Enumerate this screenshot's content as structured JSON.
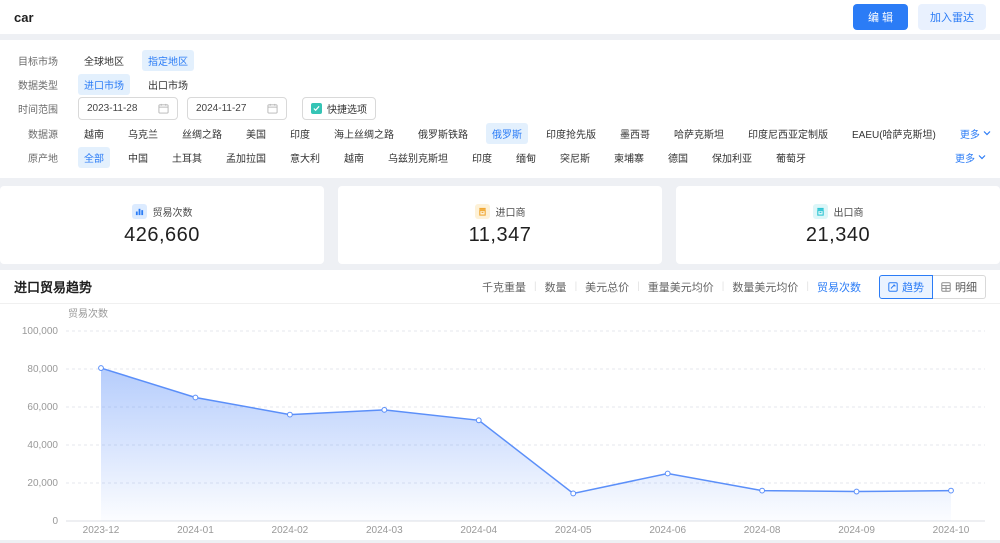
{
  "topbar": {
    "title": "car",
    "edit_label": "编 辑",
    "add_radar_label": "加入雷达"
  },
  "filters": {
    "market": {
      "label": "目标市场",
      "options": [
        {
          "text": "全球地区",
          "selected": false
        },
        {
          "text": "指定地区",
          "selected": true
        }
      ]
    },
    "data_type": {
      "label": "数据类型",
      "options": [
        {
          "text": "进口市场",
          "selected": true
        },
        {
          "text": "出口市场",
          "selected": false
        }
      ]
    },
    "date_range": {
      "label": "时间范围",
      "start": "2023-11-28",
      "end": "2024-11-27",
      "quick_label": "快捷选项"
    },
    "data_source": {
      "label": "数据源",
      "more_label": "更多",
      "options": [
        {
          "text": "越南",
          "selected": false
        },
        {
          "text": "乌克兰",
          "selected": false
        },
        {
          "text": "丝绸之路",
          "selected": false
        },
        {
          "text": "美国",
          "selected": false
        },
        {
          "text": "印度",
          "selected": false
        },
        {
          "text": "海上丝绸之路",
          "selected": false
        },
        {
          "text": "俄罗斯铁路",
          "selected": false
        },
        {
          "text": "俄罗斯",
          "selected": true
        },
        {
          "text": "印度抢先版",
          "selected": false
        },
        {
          "text": "墨西哥",
          "selected": false
        },
        {
          "text": "哈萨克斯坦",
          "selected": false
        },
        {
          "text": "印度尼西亚定制版",
          "selected": false
        },
        {
          "text": "EAEU(哈萨克斯坦)",
          "selected": false
        }
      ]
    },
    "origin": {
      "label": "原产地",
      "more_label": "更多",
      "options": [
        {
          "text": "全部",
          "selected": true
        },
        {
          "text": "中国",
          "selected": false
        },
        {
          "text": "土耳其",
          "selected": false
        },
        {
          "text": "孟加拉国",
          "selected": false
        },
        {
          "text": "意大利",
          "selected": false
        },
        {
          "text": "越南",
          "selected": false
        },
        {
          "text": "乌兹别克斯坦",
          "selected": false
        },
        {
          "text": "印度",
          "selected": false
        },
        {
          "text": "缅甸",
          "selected": false
        },
        {
          "text": "突尼斯",
          "selected": false
        },
        {
          "text": "柬埔寨",
          "selected": false
        },
        {
          "text": "德国",
          "selected": false
        },
        {
          "text": "保加利亚",
          "selected": false
        },
        {
          "text": "葡萄牙",
          "selected": false
        }
      ]
    }
  },
  "stats": [
    {
      "label": "贸易次数",
      "value": "426,660",
      "icon": "bar-chart-icon",
      "color": "#2b7cf6",
      "bg": "#dcebff"
    },
    {
      "label": "进口商",
      "value": "11,347",
      "icon": "importer-icon",
      "color": "#f0a732",
      "bg": "#fdf1d7"
    },
    {
      "label": "出口商",
      "value": "21,340",
      "icon": "exporter-icon",
      "color": "#2ec5d3",
      "bg": "#dcf6f8"
    }
  ],
  "chart_section": {
    "title": "进口贸易趋势",
    "metric_tabs": [
      {
        "label": "千克重量",
        "selected": false
      },
      {
        "label": "数量",
        "selected": false
      },
      {
        "label": "美元总价",
        "selected": false
      },
      {
        "label": "重量美元均价",
        "selected": false
      },
      {
        "label": "数量美元均价",
        "selected": false
      },
      {
        "label": "贸易次数",
        "selected": true
      }
    ],
    "view_toggle": [
      {
        "label": "趋势",
        "selected": true,
        "icon": "trend-icon"
      },
      {
        "label": "明细",
        "selected": false,
        "icon": "detail-grid-icon"
      }
    ]
  },
  "chart_data": {
    "type": "area",
    "title": "进口贸易趋势",
    "ylabel": "贸易次数",
    "xlabel": "",
    "categories": [
      "2023-12",
      "2024-01",
      "2024-02",
      "2024-03",
      "2024-04",
      "2024-05",
      "2024-06",
      "2024-08",
      "2024-09",
      "2024-10"
    ],
    "values": [
      80500,
      65000,
      56000,
      58500,
      53000,
      14500,
      25000,
      16000,
      15500,
      16000
    ],
    "ylim": [
      0,
      100000
    ],
    "yticks": [
      0,
      20000,
      40000,
      60000,
      80000,
      100000
    ],
    "grid": "horizontal-dashed",
    "legend": "none",
    "line_color": "#5b8ff9",
    "point_fill": "#ffffff",
    "area_top_color": "rgba(91,143,249,0.45)",
    "area_bottom_color": "rgba(91,143,249,0.02)",
    "axis_text_color": "#999999"
  },
  "colors": {
    "accent": "#2b7cf6",
    "selected_bg": "#e3f0fd",
    "panel": "#ffffff",
    "page_bg": "#eef0f4"
  }
}
